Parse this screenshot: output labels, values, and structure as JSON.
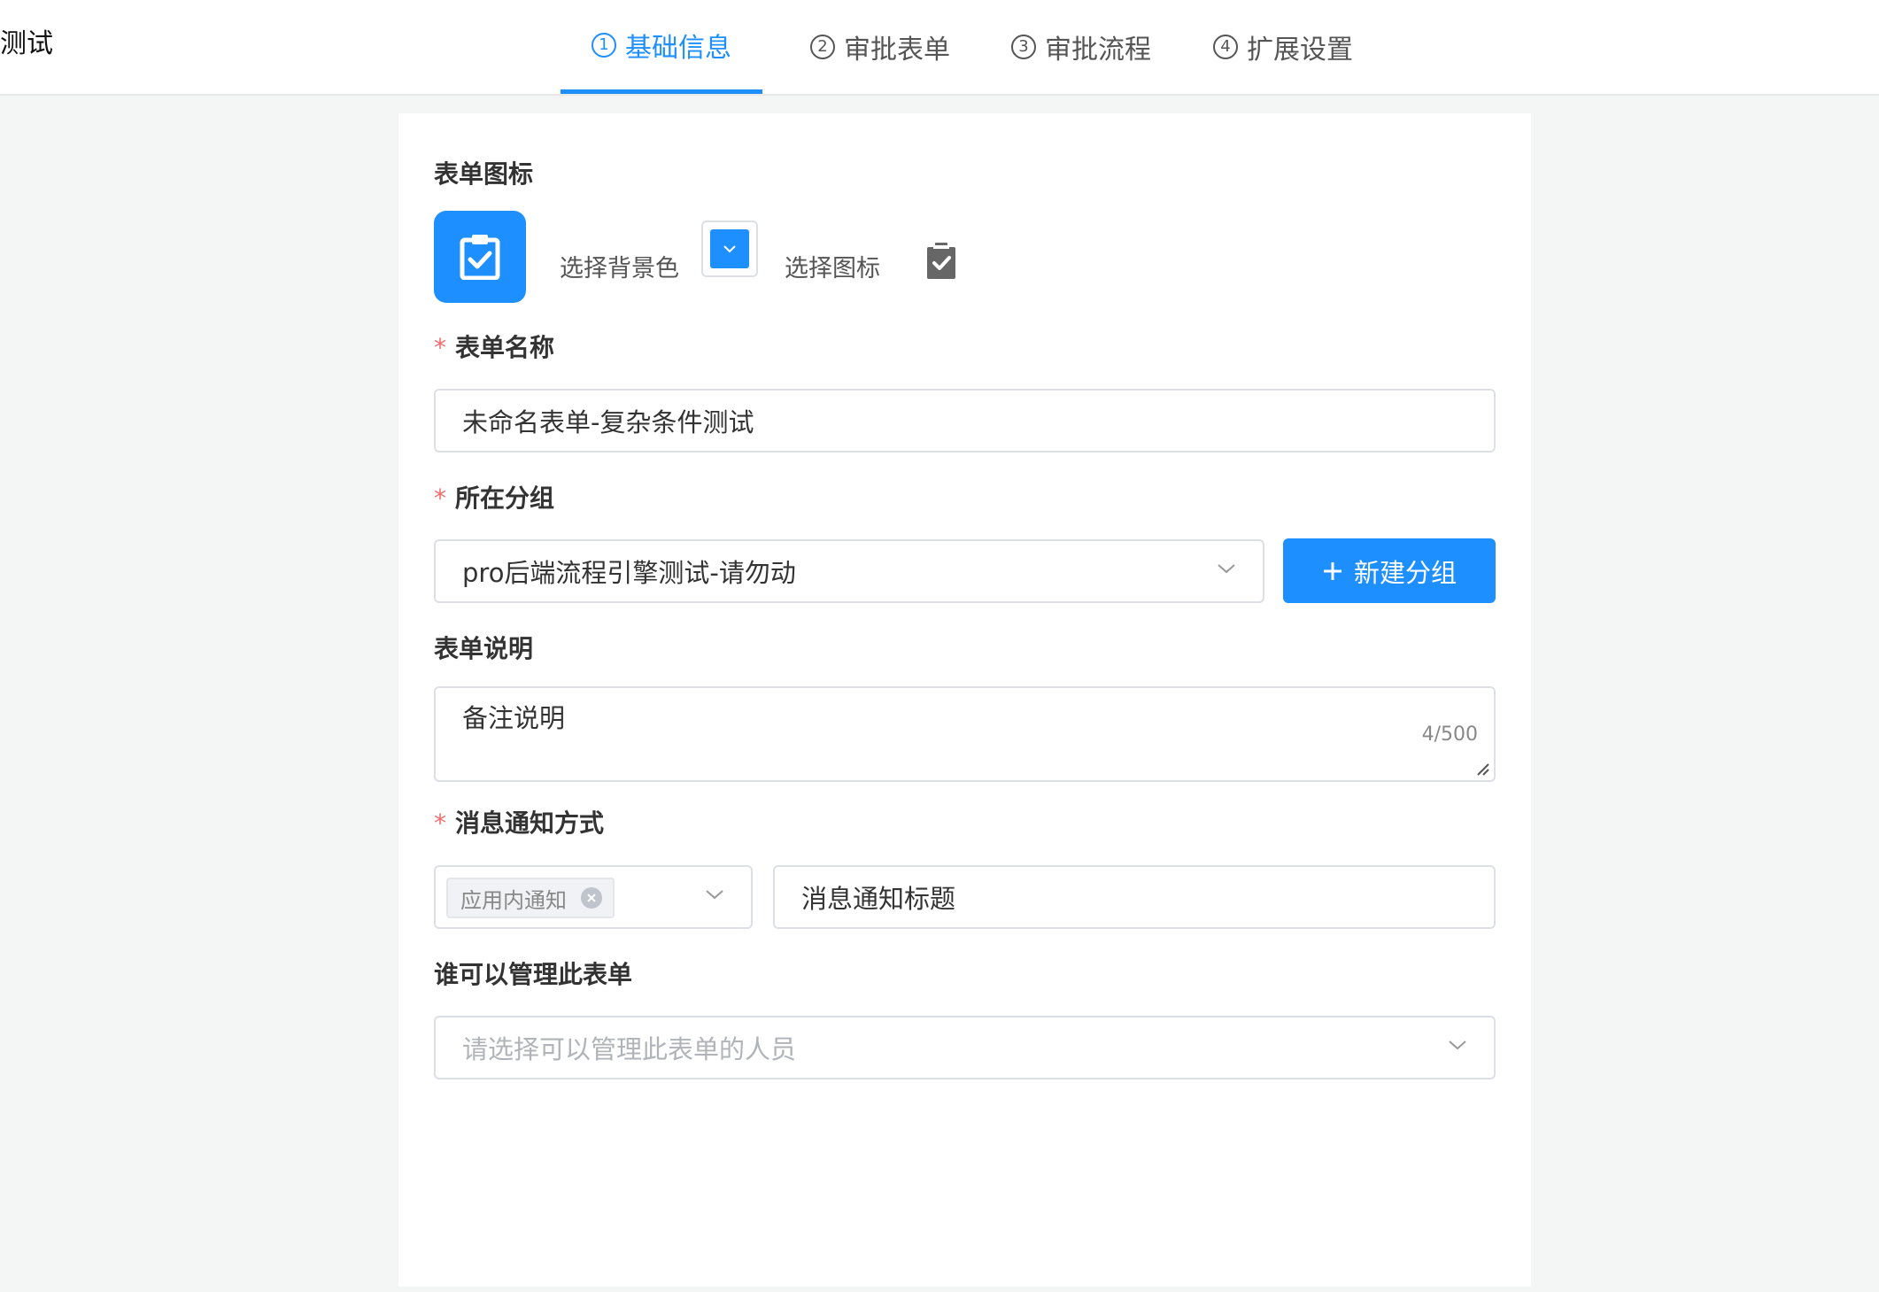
{
  "header": {
    "app_title": "测试",
    "tabs": [
      {
        "num": "1",
        "label": "基础信息",
        "active": true
      },
      {
        "num": "2",
        "label": "审批表单",
        "active": false
      },
      {
        "num": "3",
        "label": "审批流程",
        "active": false
      },
      {
        "num": "4",
        "label": "扩展设置",
        "active": false
      }
    ]
  },
  "form": {
    "icon_section": {
      "label": "表单图标",
      "bg_color_label": "选择背景色",
      "icon_label": "选择图标",
      "bg_color": "#1e8fff",
      "icon_name": "clipboard-check-icon"
    },
    "name": {
      "label": "表单名称",
      "required": "*",
      "value": "未命名表单-复杂条件测试"
    },
    "group": {
      "label": "所在分组",
      "required": "*",
      "value": "pro后端流程引擎测试-请勿动",
      "new_group_button": "新建分组"
    },
    "description": {
      "label": "表单说明",
      "value": "备注说明",
      "counter": "4/500"
    },
    "notify": {
      "label": "消息通知方式",
      "required": "*",
      "selected_tag": "应用内通知",
      "title_value": "消息通知标题"
    },
    "managers": {
      "label": "谁可以管理此表单",
      "placeholder": "请选择可以管理此表单的人员"
    }
  },
  "colors": {
    "primary": "#1e8fff",
    "required": "#f56c6c",
    "border": "#dcdfe6",
    "background": "#f4f5f5"
  }
}
